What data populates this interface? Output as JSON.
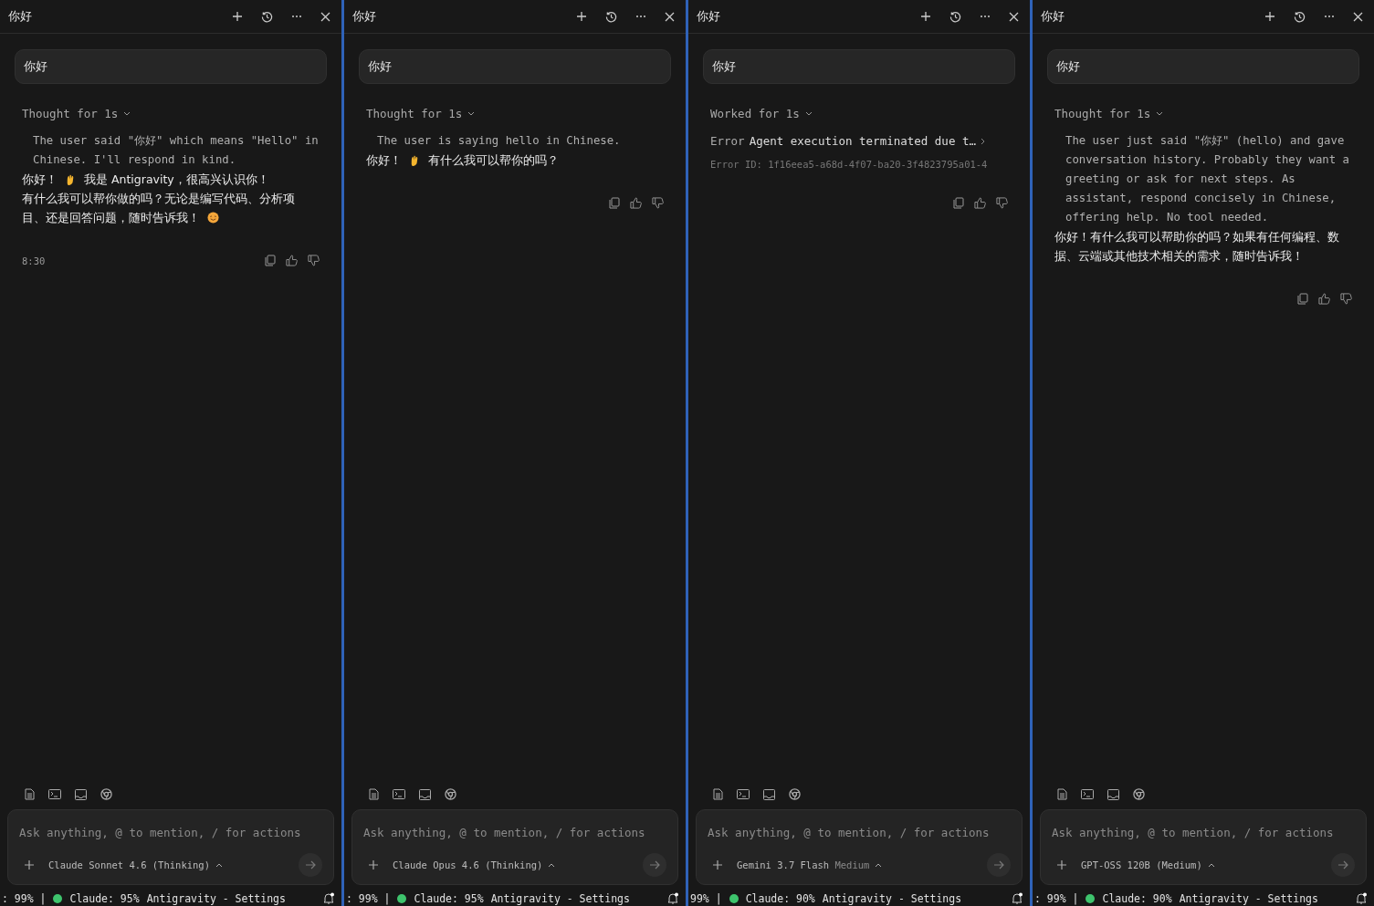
{
  "panels": [
    {
      "title": "你好",
      "user_message": "你好",
      "activity": {
        "label": "Thought for 1s",
        "kind": "thought",
        "text": "The user said \"你好\" which means \"Hello\" in Chinese. I'll respond in kind."
      },
      "response": [
        [
          {
            "kind": "text",
            "text": "你好！"
          },
          {
            "kind": "wave"
          },
          {
            "kind": "text",
            "text": "我是 Antigravity，很高兴认识你！"
          }
        ],
        [
          {
            "kind": "text",
            "text": "有什么我可以帮你做的吗？无论是编写代码、分析项"
          }
        ],
        [
          {
            "kind": "text",
            "text": "目、还是回答问题，随时告诉我！"
          },
          {
            "kind": "smile"
          }
        ]
      ],
      "time": "8:30",
      "input": {
        "placeholder": "Ask anything, @ to mention, / for actions",
        "model": "Claude Sonnet 4.6 (Thinking)"
      },
      "status": {
        "usage": ": 99% |",
        "quota": "Claude: 95%",
        "settings": "Antigravity - Settings"
      }
    },
    {
      "title": "你好",
      "user_message": "你好",
      "activity": {
        "label": "Thought for 1s",
        "kind": "thought",
        "text": "The user is saying hello in Chinese."
      },
      "response": [
        [
          {
            "kind": "text",
            "text": "你好！"
          },
          {
            "kind": "wave"
          },
          {
            "kind": "text",
            "text": "有什么我可以帮你的吗？"
          }
        ]
      ],
      "input": {
        "placeholder": "Ask anything, @ to mention, / for actions",
        "model": "Claude Opus 4.6 (Thinking)"
      },
      "status": {
        "usage": ": 99% |",
        "quota": "Claude: 95%",
        "settings": "Antigravity - Settings"
      }
    },
    {
      "title": "你好",
      "user_message": "你好",
      "activity": {
        "label": "Worked for 1s",
        "kind": "error",
        "error_label": "Error",
        "text": "Agent execution terminated due t…",
        "error_id": "Error ID: 1f16eea5-a68d-4f07-ba20-3f4823795a01-4"
      },
      "input": {
        "placeholder": "Ask anything, @ to mention, / for actions",
        "model": "Gemini 3.7 Flash",
        "model_variant": "Medium"
      },
      "status": {
        "usage": "99% |",
        "quota": "Claude: 90%",
        "settings": "Antigravity - Settings"
      }
    },
    {
      "title": "你好",
      "user_message": "你好",
      "activity": {
        "label": "Thought for 1s",
        "kind": "thought",
        "text": "The user just said \"你好\" (hello) and gave conversation history. Probably they want a greeting or ask for next steps. As assistant, respond concisely in Chinese, offering help. No tool needed."
      },
      "response": [
        [
          {
            "kind": "text",
            "text": "你好！有什么我可以帮助你的吗？如果有任何编程、数据、云端或其他技术相关的需求，随时告诉我！"
          }
        ]
      ],
      "input": {
        "placeholder": "Ask anything, @ to mention, / for actions",
        "model": "GPT-OSS 120B (Medium)"
      },
      "status": {
        "usage": ": 99% |",
        "quota": "Claude: 90%",
        "settings": "Antigravity - Settings"
      }
    }
  ]
}
